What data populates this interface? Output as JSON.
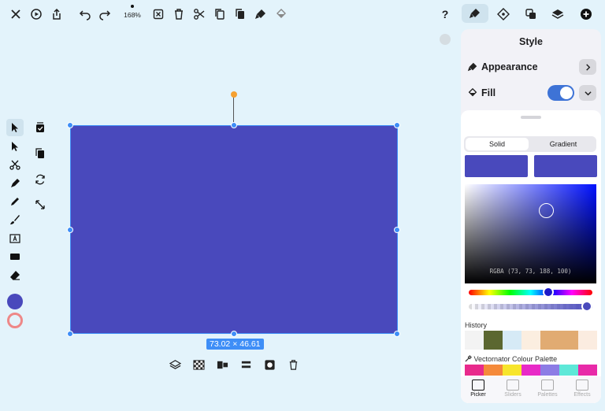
{
  "toolbar": {
    "zoom": "168%",
    "icons": [
      "close-icon",
      "play-icon",
      "share-icon",
      "undo-icon",
      "redo-icon",
      "delete-box-icon",
      "trash-icon",
      "scissors-icon",
      "copy-icon",
      "paste-icon",
      "style-copy-icon",
      "paint-bucket-icon"
    ],
    "right_icons": [
      "help-icon",
      "style-icon",
      "layout-icon",
      "arrange-icon",
      "layers-icon",
      "add-icon"
    ],
    "help": "?"
  },
  "tools": [
    "pointer-icon",
    "direct-select-icon",
    "scissors-tool-icon",
    "pen-icon",
    "pencil-icon",
    "brush-icon",
    "text-icon",
    "rectangle-icon",
    "eraser-icon"
  ],
  "secondary_tools": [
    "mask-icon",
    "duplicate-icon",
    "rotate-icon",
    "resize-icon"
  ],
  "canvas": {
    "shape_color": "#4949bc",
    "dimensions": "73.02 × 46.61"
  },
  "panel": {
    "title": "Style",
    "appearance_label": "Appearance",
    "fill_label": "Fill",
    "fill_enabled": true,
    "segment": {
      "solid": "Solid",
      "gradient": "Gradient"
    },
    "rgba": "RGBA (73, 73, 188, 100)",
    "history_label": "History",
    "history_colors": [
      "#f3f3f3",
      "#5b6730",
      "#d6eaf6",
      "#fbeee0",
      "#e1ab72",
      "#e1ab72",
      "#fbece0"
    ],
    "palette_label": "Vectornator Colour Palette",
    "palette_colors": [
      "#e82a8c",
      "#f58a3a",
      "#f7e52b",
      "#e82ac7",
      "#8c7ce5",
      "#5ee8d8",
      "#e82aa8"
    ],
    "tabs": [
      "Picker",
      "Sliders",
      "Palettes",
      "Effects"
    ]
  }
}
